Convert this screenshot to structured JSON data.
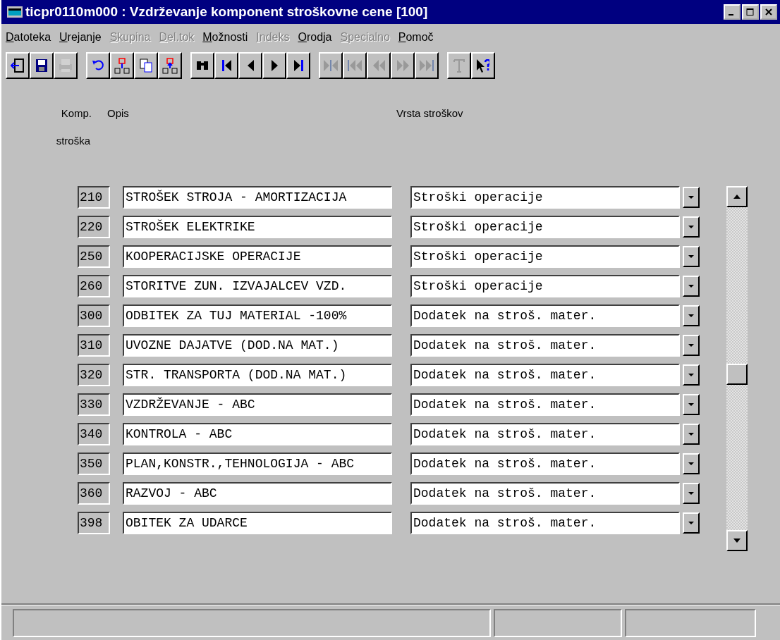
{
  "window": {
    "title": "ticpr0110m000 : Vzdrževanje komponent stroškovne cene [100]"
  },
  "menu": [
    {
      "label": "Datoteka",
      "disabled": false
    },
    {
      "label": "Urejanje",
      "disabled": false
    },
    {
      "label": "Skupina",
      "disabled": true
    },
    {
      "label": "Del.tok",
      "disabled": true
    },
    {
      "label": "Možnosti",
      "disabled": false
    },
    {
      "label": "Indeks",
      "disabled": true
    },
    {
      "label": "Orodja",
      "disabled": false
    },
    {
      "label": "Specialno",
      "disabled": true
    },
    {
      "label": "Pomoč",
      "disabled": false
    }
  ],
  "toolbar": [
    [
      {
        "kind": "exit",
        "disabled": false
      },
      {
        "kind": "save",
        "disabled": false
      },
      {
        "kind": "print",
        "disabled": true
      }
    ],
    [
      {
        "kind": "undo",
        "disabled": false
      },
      {
        "kind": "insert-below",
        "disabled": false
      },
      {
        "kind": "copy",
        "disabled": false
      },
      {
        "kind": "insert-above",
        "disabled": false
      }
    ],
    [
      {
        "kind": "find",
        "disabled": false
      },
      {
        "kind": "first",
        "disabled": false
      },
      {
        "kind": "prev",
        "disabled": false
      },
      {
        "kind": "next",
        "disabled": false
      },
      {
        "kind": "last",
        "disabled": false
      }
    ],
    [
      {
        "kind": "sync",
        "disabled": true
      },
      {
        "kind": "first-group",
        "disabled": true
      },
      {
        "kind": "prev-group",
        "disabled": true
      },
      {
        "kind": "next-group",
        "disabled": true
      },
      {
        "kind": "last-group",
        "disabled": true
      }
    ],
    [
      {
        "kind": "text",
        "disabled": true
      },
      {
        "kind": "help",
        "disabled": false
      }
    ]
  ],
  "columns": [
    {
      "lines": [
        "Komp.",
        "stroška"
      ]
    },
    {
      "lines": [
        "Opis"
      ]
    },
    {
      "lines": [
        "Vrsta stroškov"
      ]
    }
  ],
  "rows": [
    {
      "code": "210",
      "description": "STROŠEK STROJA - AMORTIZACIJA",
      "cost_type": "Stroški operacije"
    },
    {
      "code": "220",
      "description": "STROŠEK ELEKTRIKE",
      "cost_type": "Stroški operacije"
    },
    {
      "code": "250",
      "description": "KOOPERACIJSKE OPERACIJE",
      "cost_type": "Stroški operacije"
    },
    {
      "code": "260",
      "description": "STORITVE ZUN. IZVAJALCEV VZD.",
      "cost_type": "Stroški operacije"
    },
    {
      "code": "300",
      "description": "ODBITEK ZA TUJ MATERIAL -100%",
      "cost_type": "Dodatek na stroš. mater."
    },
    {
      "code": "310",
      "description": "UVOZNE DAJATVE (DOD.NA MAT.)",
      "cost_type": "Dodatek na stroš. mater."
    },
    {
      "code": "320",
      "description": "STR. TRANSPORTA (DOD.NA MAT.)",
      "cost_type": "Dodatek na stroš. mater."
    },
    {
      "code": "330",
      "description": "VZDRŽEVANJE - ABC",
      "cost_type": "Dodatek na stroš. mater."
    },
    {
      "code": "340",
      "description": "KONTROLA - ABC",
      "cost_type": "Dodatek na stroš. mater."
    },
    {
      "code": "350",
      "description": "PLAN,KONSTR.,TEHNOLOGIJA - ABC",
      "cost_type": "Dodatek na stroš. mater."
    },
    {
      "code": "360",
      "description": "RAZVOJ - ABC",
      "cost_type": "Dodatek na stroš. mater."
    },
    {
      "code": "398",
      "description": "OBITEK ZA UDARCE",
      "cost_type": "Dodatek na stroš. mater."
    }
  ]
}
